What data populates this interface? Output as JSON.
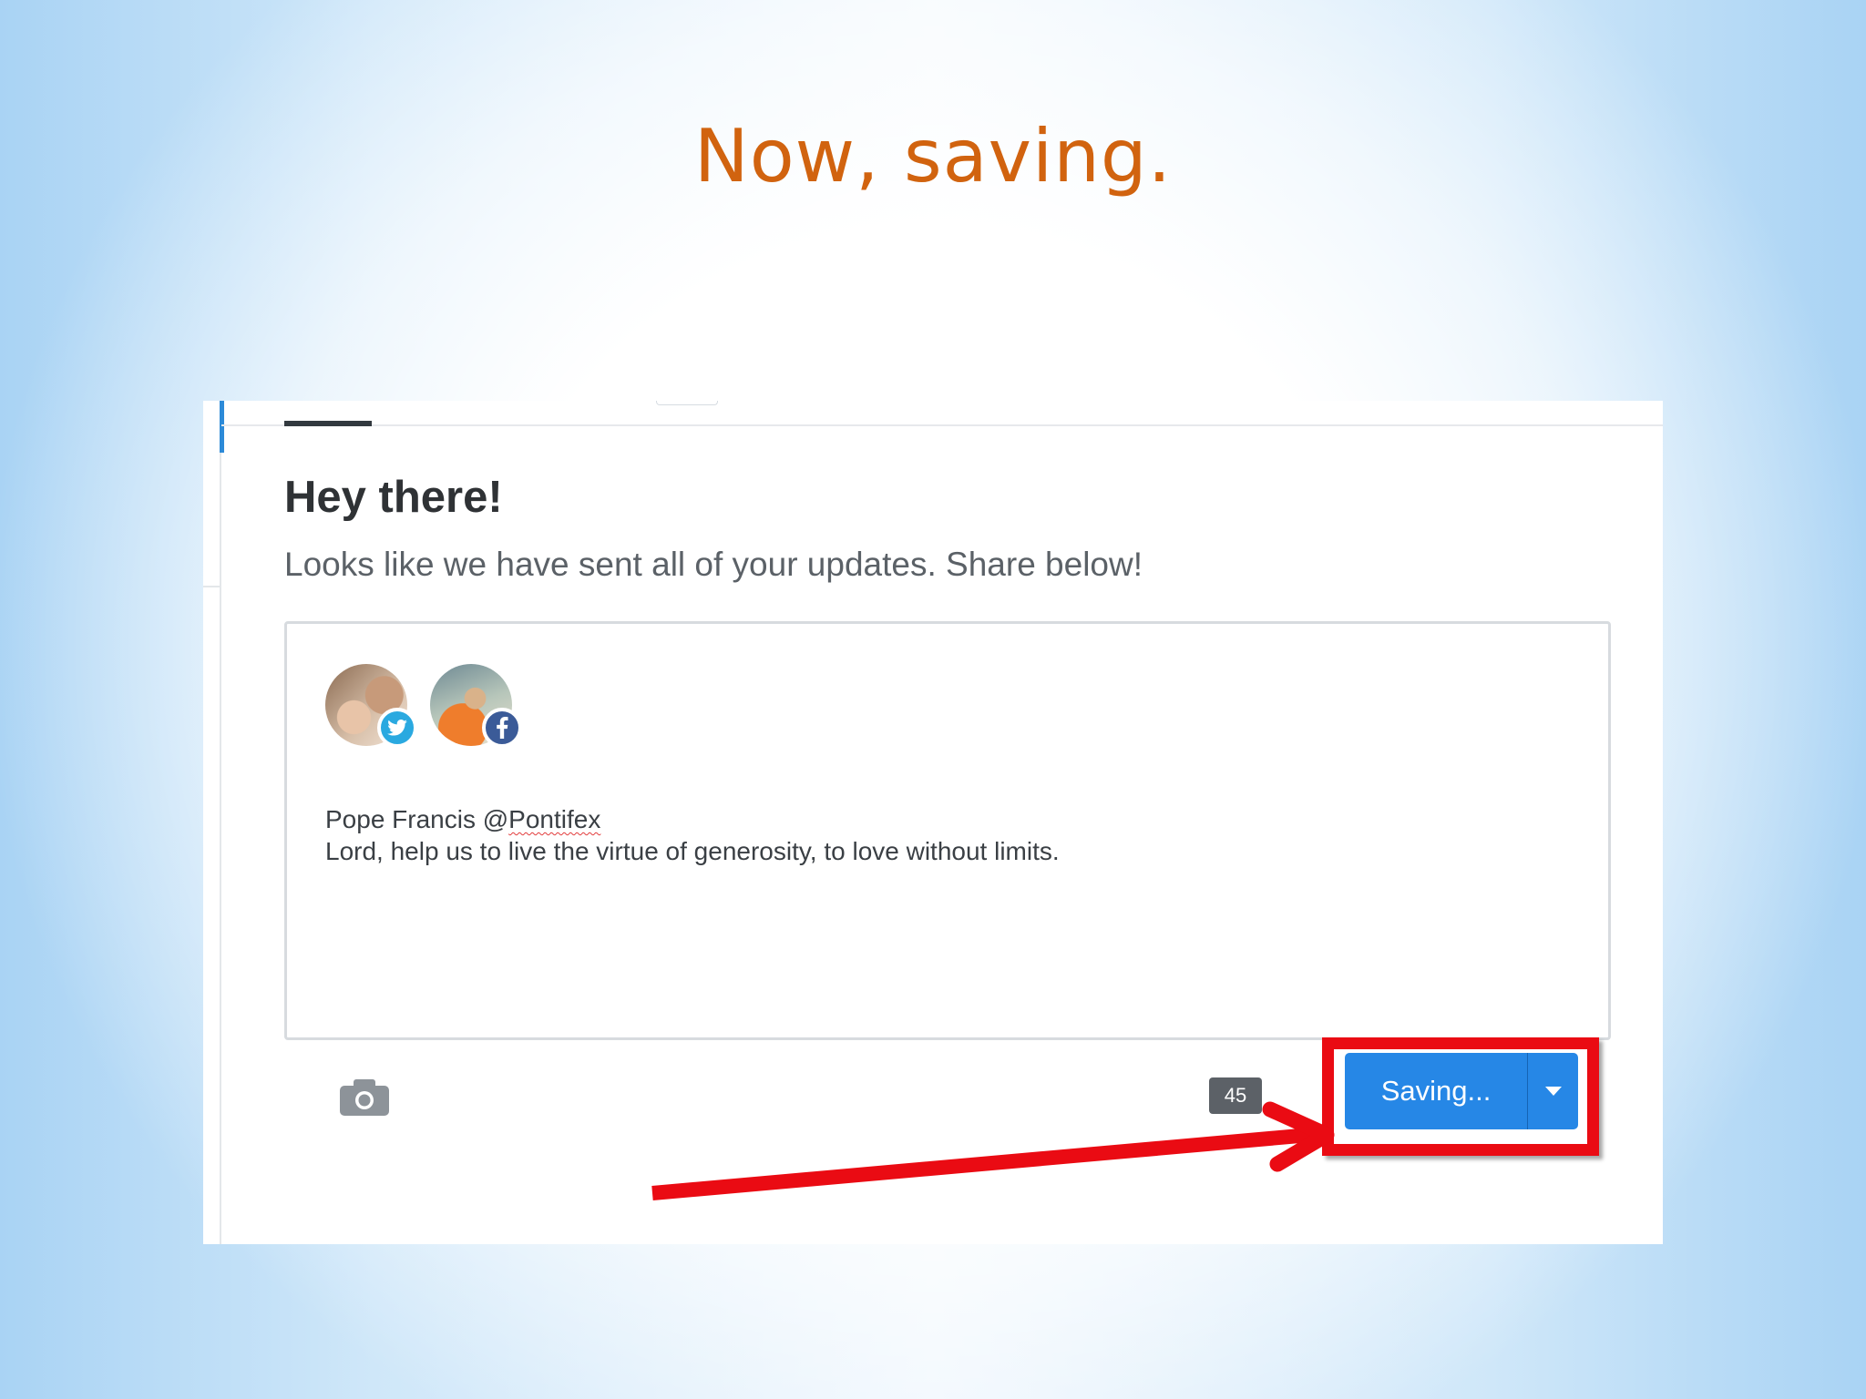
{
  "slide": {
    "title": "Now, saving."
  },
  "panel": {
    "heading": "Hey there!",
    "subtext": "Looks like we have sent all of your updates. Share below!"
  },
  "composer": {
    "profiles": [
      {
        "network": "twitter",
        "icon": "twitter-icon"
      },
      {
        "network": "facebook",
        "icon": "facebook-icon"
      }
    ],
    "post_line_1_prefix": "Pope Francis @",
    "post_line_1_handle": "Pontifex",
    "post_line_2": "Lord, help us to live the virtue of generosity, to love without limits.",
    "char_count": "45",
    "camera_icon": "camera-icon"
  },
  "actions": {
    "save_label": "Saving...",
    "dropdown_icon": "caret-down-icon"
  },
  "annotation": {
    "color": "#ea0b13"
  },
  "colors": {
    "title": "#d1630f",
    "accent": "#2687e6",
    "twitter": "#2aa9e0",
    "facebook": "#3b5b98"
  }
}
